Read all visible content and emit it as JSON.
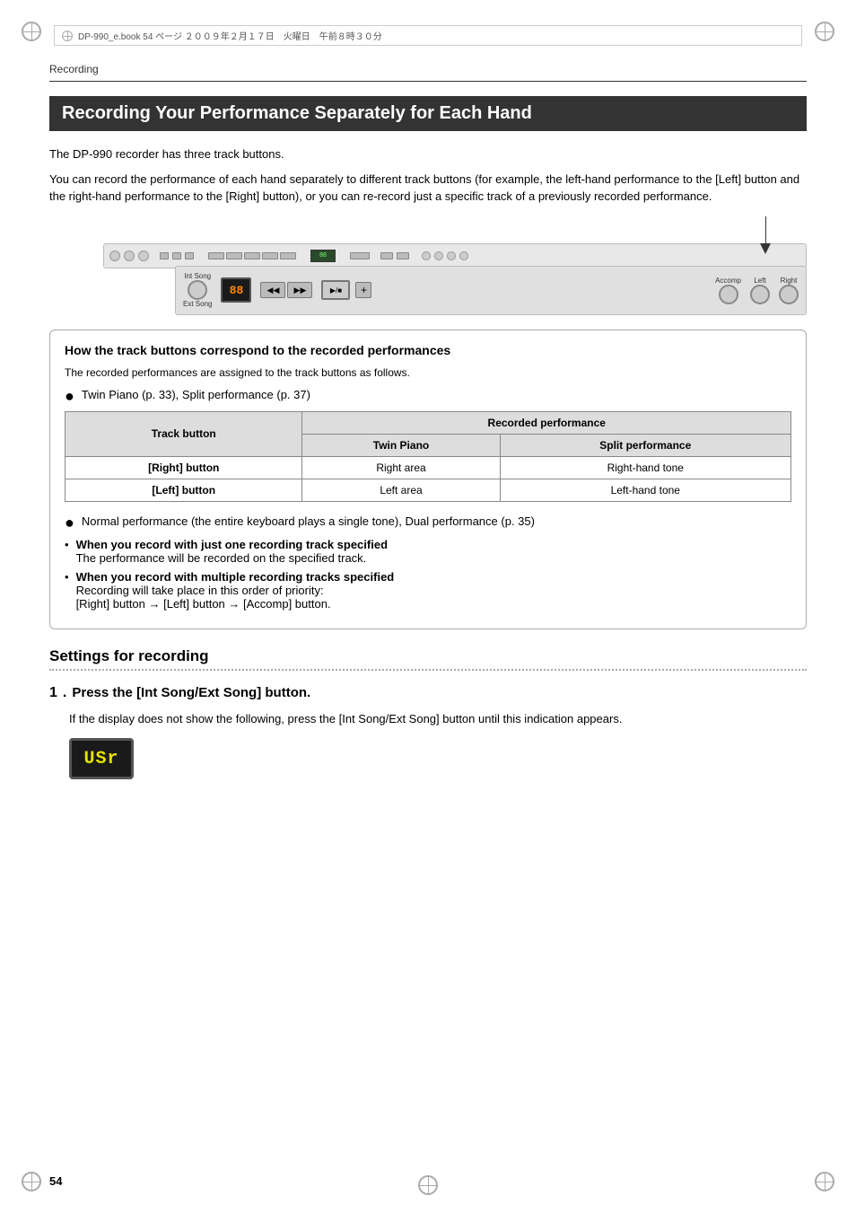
{
  "page": {
    "number": "54",
    "header_file_info": "DP-990_e.book  54 ページ  ２００９年２月１７日　火曜日　午前８時３０分"
  },
  "breadcrumb": "Recording",
  "section_title": "Recording Your Performance Separately for Each Hand",
  "intro_paragraph_1": "The DP-990 recorder has three track buttons.",
  "intro_paragraph_2": "You can record the performance of each hand separately to different track buttons (for example, the left-hand performance to the [Left] button and the right-hand performance to the [Right] button), or you can re-record just a specific track of a previously recorded performance.",
  "info_box": {
    "title": "How the track buttons correspond to the recorded performances",
    "subtitle": "The recorded performances are assigned to the track buttons as follows.",
    "bullet1": {
      "text": "Twin Piano (p. 33), Split performance (p. 37)"
    },
    "table": {
      "col1_header": "Track button",
      "col2_header": "Recorded performance",
      "col2a_header": "Twin Piano",
      "col2b_header": "Split performance",
      "row1_col1": "[Right] button",
      "row1_col2a": "Right area",
      "row1_col2b": "Right-hand tone",
      "row2_col1": "[Left] button",
      "row2_col2a": "Left area",
      "row2_col2b": "Left-hand tone"
    },
    "bullet2": {
      "text": "Normal performance (the entire keyboard plays a single tone), Dual performance (p. 35)"
    },
    "dash1_label": "When you record with just one recording track specified",
    "dash1_text": "The performance will be recorded on the specified track.",
    "dash2_label": "When you record with multiple recording tracks specified",
    "dash2_text1": "Recording will take place in this order of priority:",
    "dash2_text2": "[Right] button → [Left] button → [Accomp] button."
  },
  "settings_section": {
    "title": "Settings for recording",
    "step1": {
      "number": "1",
      "label": "Press the [Int Song/Ext Song] button.",
      "description": "If the display does not show the following, press the [Int Song/Ext Song] button until this indication appears.",
      "display_text": "USr"
    }
  },
  "device": {
    "display_value": "88",
    "labels": {
      "int_song": "Int Song",
      "ext_song": "Ext Song",
      "accomp": "Accomp",
      "left": "Left",
      "right": "Right"
    }
  }
}
